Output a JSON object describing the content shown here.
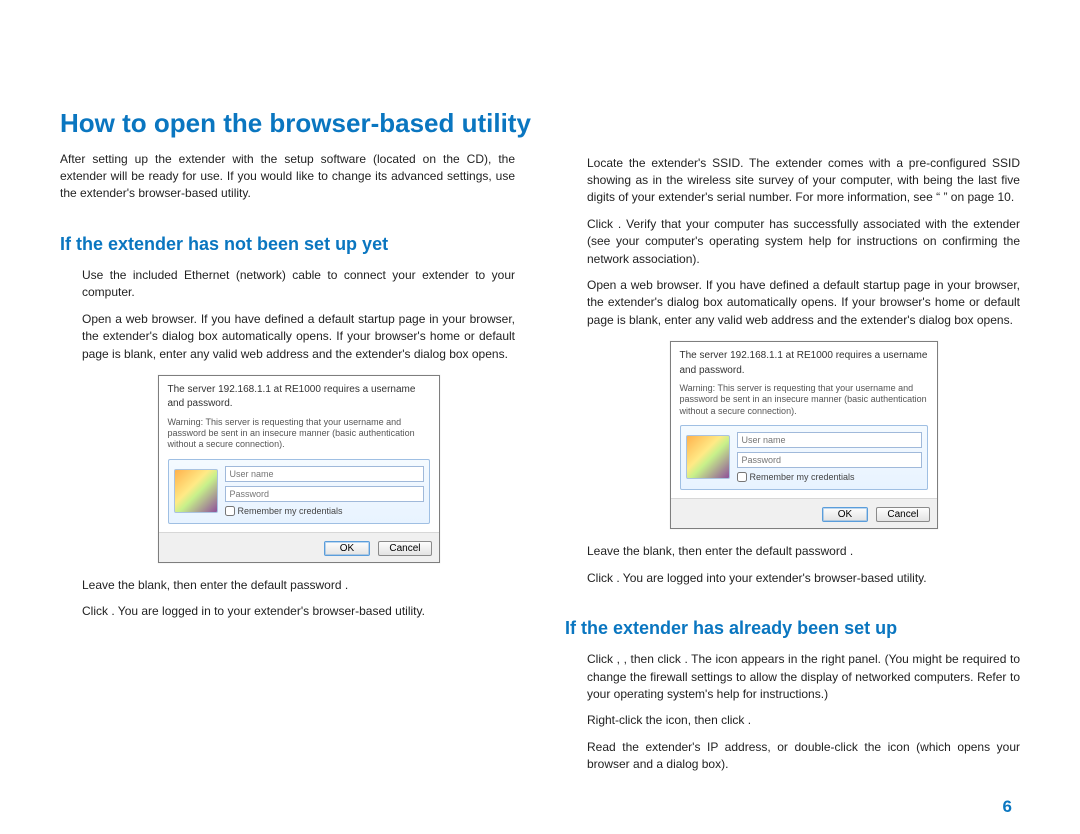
{
  "title": "How to open the browser-based utility",
  "intro": "After setting up the extender with the setup software (located on the CD), the extender will be ready for use. If you would like to change its advanced settings, use the extender's browser-based utility.",
  "left": {
    "heading": "If the extender has not been set up yet",
    "s1": "Use the included Ethernet (network) cable to connect your extender to your computer.",
    "s2a": "Open a web browser. If you have defined a default startup page in your browser, the extender's ",
    "s2b": " dialog box automatically opens. If your browser's home or default page is blank, enter any valid web address and the extender's ",
    "s2c": " dialog box opens.",
    "s3a": "Leave the ",
    "s3b": " blank, then enter the default password ",
    "s3c": ".",
    "s4a": "Click ",
    "s4b": ". You are logged in to your extender's browser-based utility."
  },
  "right": {
    "r1a": "Locate the extender's SSID. The extender comes with a pre-configured SSID showing as ",
    "r1b": " in the wireless site survey of your computer, with ",
    "r1c": " being the last five digits of your extender's serial number. For more information, see “",
    "r1d": "” on page 10.",
    "r2a": "Click ",
    "r2b": ". Verify that your computer has successfully associated with the extender (see your computer's operating system help for instructions on confirming the network association).",
    "r3a": "Open a web browser. If you have defined a default startup page in your browser, the extender's ",
    "r3b": " dialog box automatically opens. If your browser's home or default page is blank, enter any valid web address and the extender's ",
    "r3c": " dialog box opens.",
    "r4a": "Leave the ",
    "r4b": " blank, then enter the default password ",
    "r4c": ".",
    "r5a": "Click ",
    "r5b": ". You are logged into your extender's browser-based utility.",
    "heading2": "If the extender has already been set up",
    "b1a": "Click ",
    "b1b": ", ",
    "b1c": ", then click ",
    "b1d": ". The icon appears in the right panel. (You might be required to change the firewall settings to allow the display of networked computers. Refer to your operating system's help for instructions.)",
    "b2a": "Right-click the ",
    "b2b": " icon, then click ",
    "b2c": ".",
    "b3a": "Read the extender's IP address, or double-click the icon (which opens your browser and a ",
    "b3b": " dialog box)."
  },
  "dialog": {
    "title": "The server 192.168.1.1 at RE1000 requires a username and password.",
    "warn": "Warning: This server is requesting that your username and password be sent in an insecure manner (basic authentication without a secure connection).",
    "user_ph": "User name",
    "pass_ph": "Password",
    "remember": "Remember my credentials",
    "ok": "OK",
    "cancel": "Cancel"
  },
  "page_number": "6"
}
